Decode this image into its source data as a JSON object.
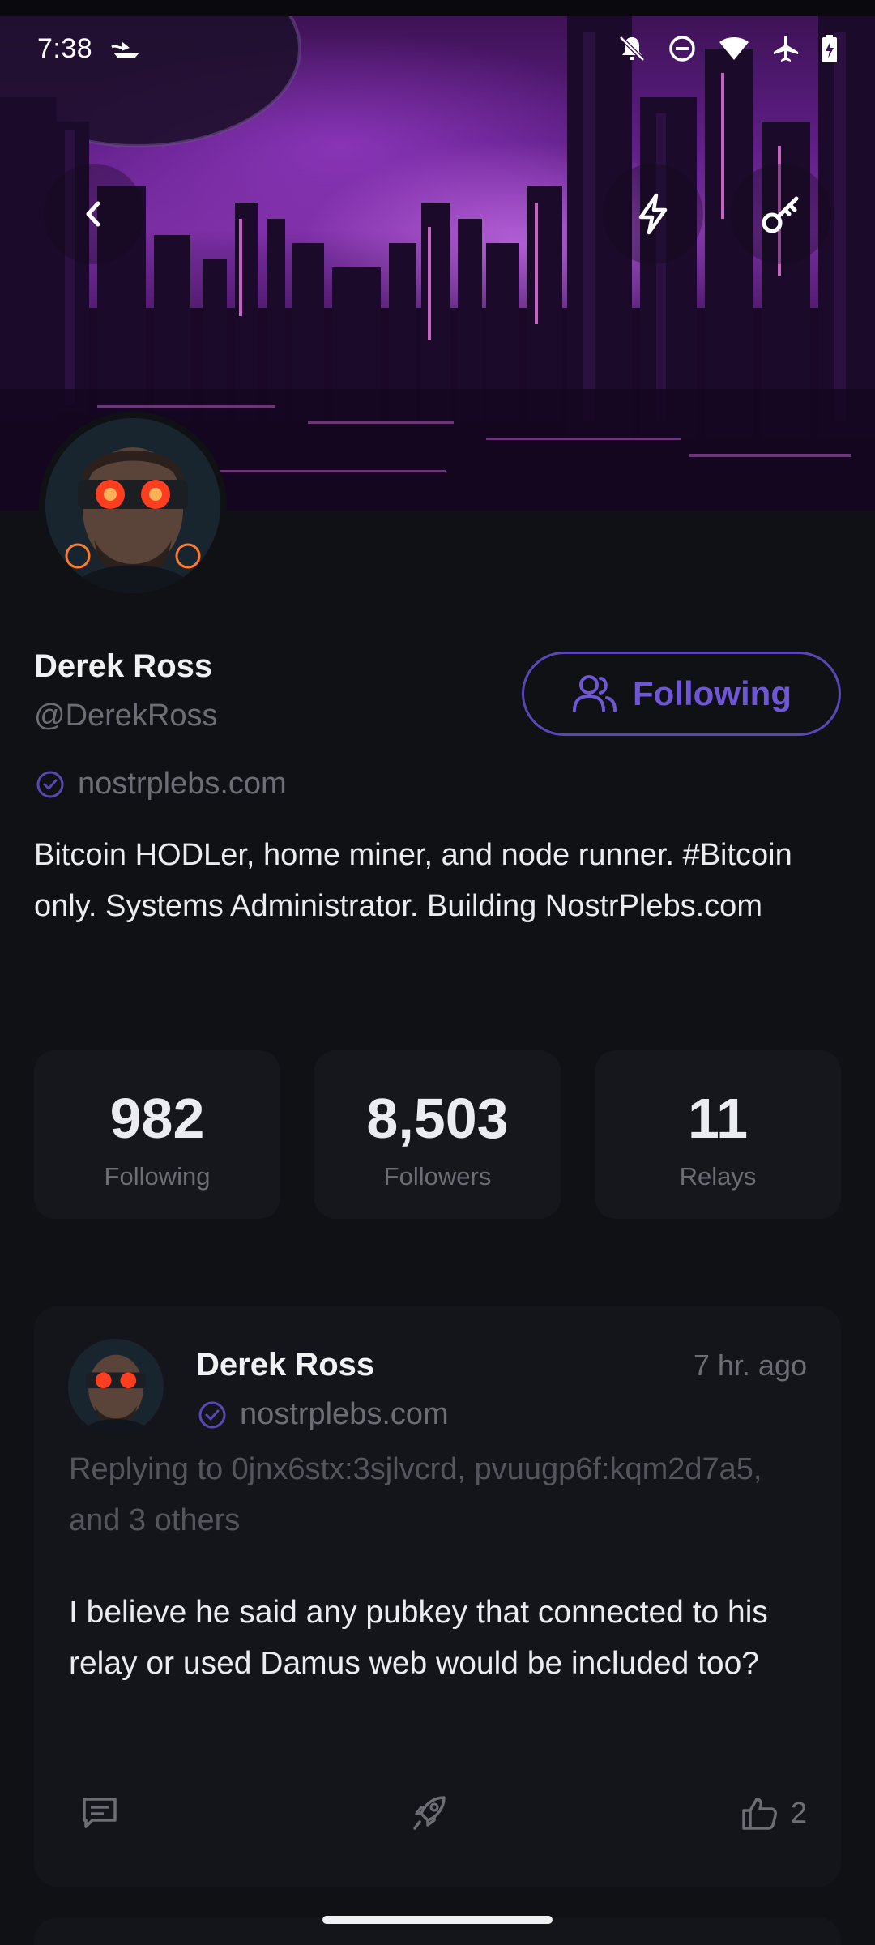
{
  "status_bar": {
    "time": "7:38",
    "icons": [
      "boat-notification-icon",
      "bell-off-icon",
      "do-not-disturb-icon",
      "wifi-icon",
      "airplane-icon",
      "battery-charging-icon"
    ]
  },
  "header": {
    "back_icon": "chevron-left-icon",
    "zap_icon": "lightning-icon",
    "key_icon": "key-icon"
  },
  "profile": {
    "name": "Derek Ross",
    "handle": "@DerekRoss",
    "nip05": "nostrplebs.com",
    "follow_button_label": "Following",
    "bio": "Bitcoin HODLer, home miner, and node runner. #Bitcoin only. Systems Administrator. Building NostrPlebs.com"
  },
  "stats": [
    {
      "value": "982",
      "label": "Following"
    },
    {
      "value": "8,503",
      "label": "Followers"
    },
    {
      "value": "11",
      "label": "Relays"
    }
  ],
  "post": {
    "author": "Derek Ross",
    "nip05": "nostrplebs.com",
    "time": "7 hr. ago",
    "replying_to": "Replying to 0jnx6stx:3sjlvcrd, pvuugp6f:kqm2d7a5, and 3 others",
    "content": "I believe he said any pubkey that connected to his relay or used Damus web would be included too?",
    "like_count": "2"
  },
  "colors": {
    "background": "#0f1115",
    "card": "#14151b",
    "accent": "#6f56d6",
    "muted": "#6d6d76"
  }
}
